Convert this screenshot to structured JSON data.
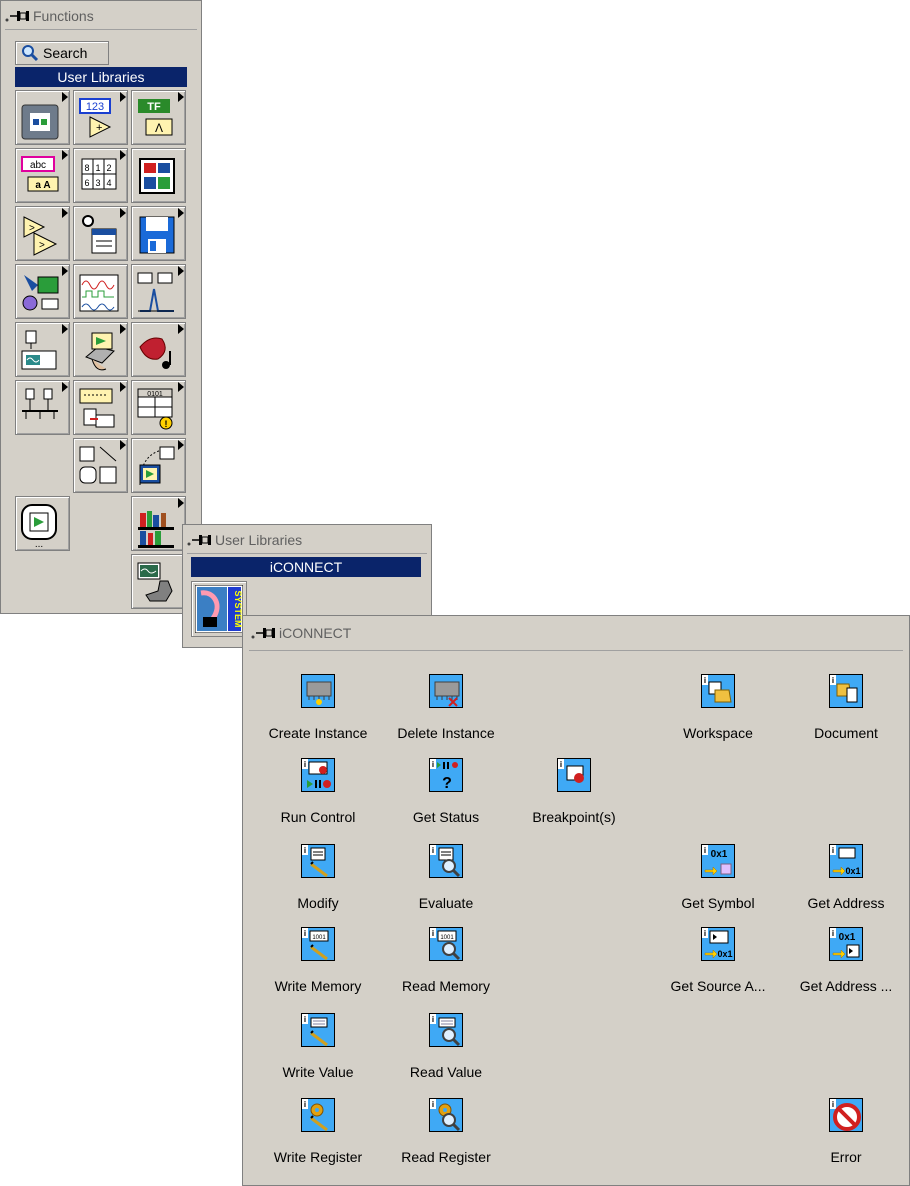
{
  "functions_palette": {
    "title": "Functions",
    "search_label": "Search",
    "header": "User Libraries",
    "tiles": [
      {
        "icon": "structures-icon"
      },
      {
        "icon": "numeric-icon"
      },
      {
        "icon": "boolean-icon"
      },
      {
        "icon": "string-icon"
      },
      {
        "icon": "array-icon"
      },
      {
        "icon": "cluster-icon"
      },
      {
        "icon": "comparison-icon"
      },
      {
        "icon": "timing-icon"
      },
      {
        "icon": "file-io-icon"
      },
      {
        "icon": "data-acquisition-icon"
      },
      {
        "icon": "waveform-icon"
      },
      {
        "icon": "analyze-icon"
      },
      {
        "icon": "instrument-io-icon"
      },
      {
        "icon": "motion-vision-icon"
      },
      {
        "icon": "graphics-sound-icon"
      },
      {
        "icon": "communication-icon"
      },
      {
        "icon": "report-generation-icon"
      },
      {
        "icon": "advanced-icon"
      },
      {
        "icon": "empty"
      },
      {
        "icon": "decorations-icon"
      },
      {
        "icon": "select-vi-icon"
      },
      {
        "icon": "express-icon"
      },
      {
        "icon": "empty"
      },
      {
        "icon": "user-libraries-icon"
      },
      {
        "icon": "empty"
      },
      {
        "icon": "empty"
      },
      {
        "icon": "instrument-drivers-icon"
      }
    ]
  },
  "user_libraries_palette": {
    "title": "User Libraries",
    "header": "iCONNECT",
    "item_icon": "isystem-icon"
  },
  "iconnect_palette": {
    "title": "iCONNECT",
    "items": [
      {
        "label": "Create Instance",
        "icon": "create-instance-icon"
      },
      {
        "label": "Delete Instance",
        "icon": "delete-instance-icon"
      },
      {
        "label": "Workspace",
        "icon": "workspace-icon"
      },
      {
        "label": "Document",
        "icon": "document-icon"
      },
      {
        "label": "Run Control",
        "icon": "run-control-icon"
      },
      {
        "label": "Get Status",
        "icon": "get-status-icon"
      },
      {
        "label": "Breakpoint(s)",
        "icon": "breakpoint-icon"
      },
      {
        "label": "Modify",
        "icon": "modify-icon"
      },
      {
        "label": "Evaluate",
        "icon": "evaluate-icon"
      },
      {
        "label": "Get Symbol",
        "icon": "get-symbol-icon"
      },
      {
        "label": "Get Address",
        "icon": "get-address-icon"
      },
      {
        "label": "Write Memory",
        "icon": "write-memory-icon"
      },
      {
        "label": "Read Memory",
        "icon": "read-memory-icon"
      },
      {
        "label": "Get Source A...",
        "icon": "get-source-address-icon"
      },
      {
        "label": "Get Address ...",
        "icon": "get-address-source-icon"
      },
      {
        "label": "Write Value",
        "icon": "write-value-icon"
      },
      {
        "label": "Read Value",
        "icon": "read-value-icon"
      },
      {
        "label": "Write Register",
        "icon": "write-register-icon"
      },
      {
        "label": "Read Register",
        "icon": "read-register-icon"
      },
      {
        "label": "Error",
        "icon": "error-icon"
      }
    ],
    "badge_text": "i",
    "hex_text": "0x1"
  },
  "colors": {
    "palette_bg": "#d4d0c8",
    "header_bg": "#0a246a",
    "icon_bg": "#3fa9f5"
  }
}
